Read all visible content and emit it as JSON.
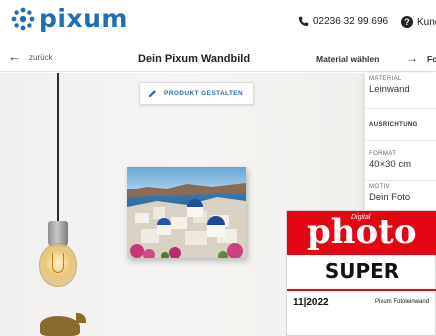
{
  "header": {
    "logo_text": "pixum",
    "phone": "02236 32 99 696",
    "help_label": "Kund"
  },
  "subnav": {
    "back_label": "zurück",
    "title": "Dein Pixum Wandbild",
    "step_label": "Material wählen",
    "next_label": "Fo"
  },
  "editor": {
    "design_button": "PRODUKT GESTALTEN"
  },
  "options": [
    {
      "label": "MATERIAL",
      "value": "Leinwand"
    },
    {
      "label": "AUSRICHTUNG",
      "value": ""
    },
    {
      "label": "FORMAT",
      "value": "40×30 cm"
    },
    {
      "label": "MOTIV",
      "value": "Dein Foto"
    }
  ],
  "badge": {
    "digital": "Digital",
    "photo": "photo",
    "rating": "SUPER",
    "issue": "11|2022",
    "product": "Pixum Fotoleinwand"
  },
  "colors": {
    "brand_blue": "#1f6fb4",
    "badge_red": "#e30613"
  },
  "icons": [
    "pixum-star-logo",
    "phone-icon",
    "help-icon",
    "back-arrow-icon",
    "next-arrow-icon",
    "pencil-icon"
  ]
}
